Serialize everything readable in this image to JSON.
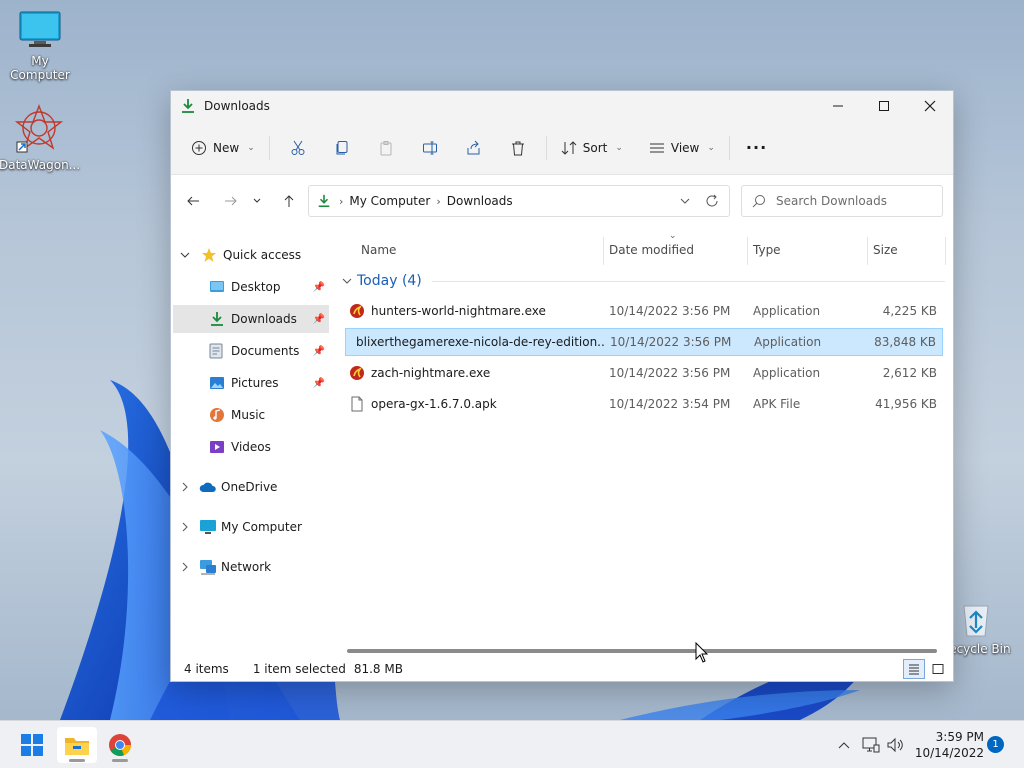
{
  "desktop": {
    "icons": [
      {
        "label": "My Computer"
      },
      {
        "label": "DataWagon..."
      },
      {
        "label": "Recycle Bin"
      }
    ]
  },
  "window": {
    "title": "Downloads",
    "toolbar": {
      "new_label": "New",
      "sort_label": "Sort",
      "view_label": "View",
      "more_label": "..."
    },
    "address": {
      "crumbs": [
        "My Computer",
        "Downloads"
      ],
      "search_placeholder": "Search Downloads"
    },
    "nav": {
      "quick_access": "Quick access",
      "items": [
        "Desktop",
        "Downloads",
        "Documents",
        "Pictures",
        "Music",
        "Videos"
      ],
      "roots": [
        "OneDrive",
        "My Computer",
        "Network"
      ]
    },
    "columns": {
      "name": "Name",
      "date": "Date modified",
      "type": "Type",
      "size": "Size"
    },
    "group_label": "Today (4)",
    "files": [
      {
        "name": "hunters-world-nightmare.exe",
        "date": "10/14/2022 3:56 PM",
        "type": "Application",
        "size": "4,225 KB",
        "icon": "exe-icon"
      },
      {
        "name": "blixerthegamerexe-nicola-de-rey-edition...",
        "date": "10/14/2022 3:56 PM",
        "type": "Application",
        "size": "83,848 KB",
        "icon": "game-icon",
        "selected": true
      },
      {
        "name": "zach-nightmare.exe",
        "date": "10/14/2022 3:56 PM",
        "type": "Application",
        "size": "2,612 KB",
        "icon": "exe-icon"
      },
      {
        "name": "opera-gx-1.6.7.0.apk",
        "date": "10/14/2022 3:54 PM",
        "type": "APK File",
        "size": "41,956 KB",
        "icon": "file-icon"
      }
    ],
    "status": {
      "items": "4 items",
      "selected": "1 item selected",
      "size": "81.8 MB"
    }
  },
  "taskbar": {
    "time": "3:59 PM",
    "date": "10/14/2022",
    "notifications": "1"
  },
  "colors": {
    "accent": "#0067c0",
    "selection": "#cce8ff",
    "group": "#1a5fb4"
  }
}
